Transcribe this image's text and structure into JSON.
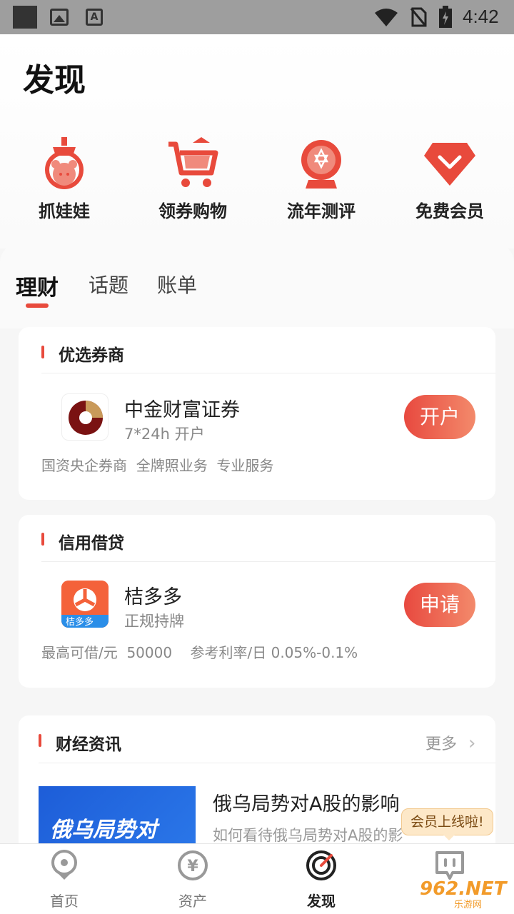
{
  "status_bar": {
    "time": "4:42"
  },
  "page_title": "发现",
  "shortcuts": [
    {
      "label": "抓娃娃",
      "icon": "claw-machine-icon"
    },
    {
      "label": "领券购物",
      "icon": "shopping-cart-icon"
    },
    {
      "label": "流年测评",
      "icon": "crystal-ball-icon"
    },
    {
      "label": "免费会员",
      "icon": "vip-diamond-icon"
    }
  ],
  "tabs": [
    {
      "label": "理财",
      "active": true
    },
    {
      "label": "话题",
      "active": false
    },
    {
      "label": "账单",
      "active": false
    }
  ],
  "broker": {
    "section_title": "优选券商",
    "name": "中金财富证券",
    "subtitle": "7*24h 开户",
    "tags": "国资央企券商  全牌照业务  专业服务",
    "action": "开户"
  },
  "loan": {
    "section_title": "信用借贷",
    "name": "桔多多",
    "subtitle": "正规持牌",
    "detail": "最高可借/元  50000    参考利率/日 0.05%-0.1%",
    "action": "申请",
    "logo_text": "桔多多"
  },
  "news": {
    "section_title": "财经资讯",
    "more_label": "更多",
    "item_title": "俄乌局势对A股的影响",
    "item_subtitle": "如何看待俄乌局势对A股的影",
    "image_text": "俄乌局势对"
  },
  "tooltip": "会员上线啦!",
  "bottom_nav": [
    {
      "label": "首页",
      "icon": "home-location-icon",
      "active": false
    },
    {
      "label": "资产",
      "icon": "yuan-coin-icon",
      "active": false
    },
    {
      "label": "发现",
      "icon": "discover-target-icon",
      "active": true
    },
    {
      "label": "",
      "icon": "member-face-icon",
      "active": false
    }
  ],
  "watermark": {
    "big": "962.NET",
    "small": "乐游网"
  },
  "colors": {
    "accent": "#e84a3c",
    "pill_end": "#f38a6b",
    "news_blue": "#1d5dd8"
  }
}
